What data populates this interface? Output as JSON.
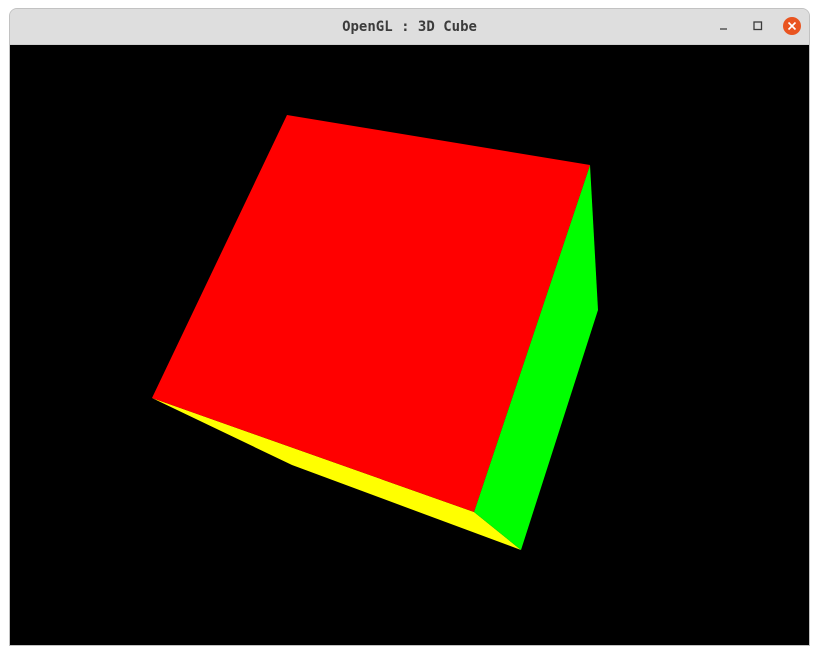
{
  "window": {
    "title": "OpenGL : 3D Cube"
  },
  "controls": {
    "minimize_icon": "minimize-icon",
    "maximize_icon": "maximize-icon",
    "close_icon": "close-icon",
    "close_color": "#e95420"
  },
  "scene": {
    "background": "#000000",
    "faces": [
      {
        "name": "front-face",
        "color": "#ff0000"
      },
      {
        "name": "right-face",
        "color": "#00ff00"
      },
      {
        "name": "bottom-face",
        "color": "#ffff00"
      }
    ]
  }
}
